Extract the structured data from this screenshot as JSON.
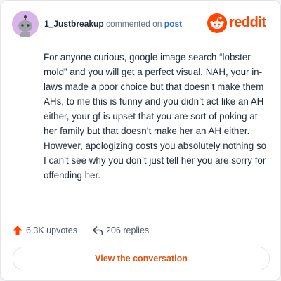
{
  "comment": {
    "username": "1_Justbreakup",
    "action_text": "commented on",
    "post_link": "post",
    "body": "For anyone curious, google image search “lobster mold” and you will get a perfect visual. NAH, your in-laws made a poor choice but that doesn’t make them AHs, to me this is funny and you didn’t act like an AH either, your gf is upset that you are sort of poking at her family but that doesn’t make her an AH either. However, apologizing costs you absolutely nothing so I can’t see why you don’t just tell her you are sorry for offending her."
  },
  "brand": {
    "wordmark": "reddit",
    "color": "#ff4500",
    "icon": "reddit-logo-icon"
  },
  "stats": {
    "upvotes": "6.3K upvotes",
    "upvote_icon": "upvote-arrow-icon",
    "replies": "206 replies",
    "reply_icon": "reply-arrow-icon"
  },
  "cta": {
    "label": "View the conversation"
  },
  "colors": {
    "accent": "#ff4500",
    "link": "#2a6fd6",
    "avatar_bg": "#d8b5e8"
  }
}
